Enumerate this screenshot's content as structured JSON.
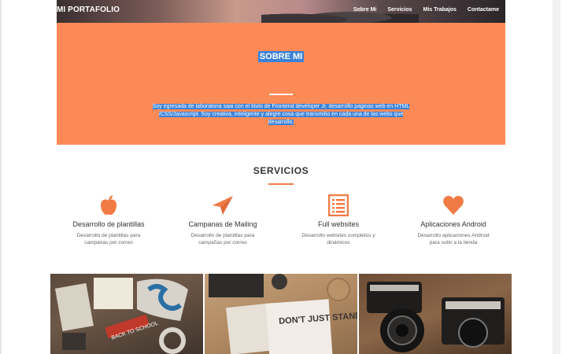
{
  "header": {
    "brand": "MI PORTAFOLIO",
    "nav": [
      "Sobre Mi",
      "Servicios",
      "Mis Trabajos",
      "Contactame"
    ]
  },
  "about": {
    "title": "SOBRE MI",
    "text": "Soy egresada de laboratoria saai con el titulo de Frontend developer Jr. desarrollo paginas web en HTML /CSS/Javascript. Soy creativa, inteligente y alegre cosa que transmitio en cada una de las webs que desarrollo."
  },
  "services": {
    "title": "SERVICIOS",
    "items": [
      {
        "icon": "apple-icon",
        "name": "Desarrollo de plantillas",
        "desc": "Desarrollo de plantillas para campanas por correo"
      },
      {
        "icon": "paper-plane-icon",
        "name": "Campanas de Mailing",
        "desc": "Desarrollo de plantillas para campañas por correo"
      },
      {
        "icon": "list-icon",
        "name": "Full websites",
        "desc": "Desarrollo websites completos y dinámicos"
      },
      {
        "icon": "heart-icon",
        "name": "Aplicaciones Android",
        "desc": "Desarrollo aplicaciones Android para subir a la tienda"
      }
    ]
  },
  "gallery": {
    "photo_texts": [
      "BACK TO SCHOOL",
      "DON'T JUST STAND THERE"
    ]
  },
  "colors": {
    "accent": "#fc8a57",
    "highlight": "#3b82d8"
  }
}
